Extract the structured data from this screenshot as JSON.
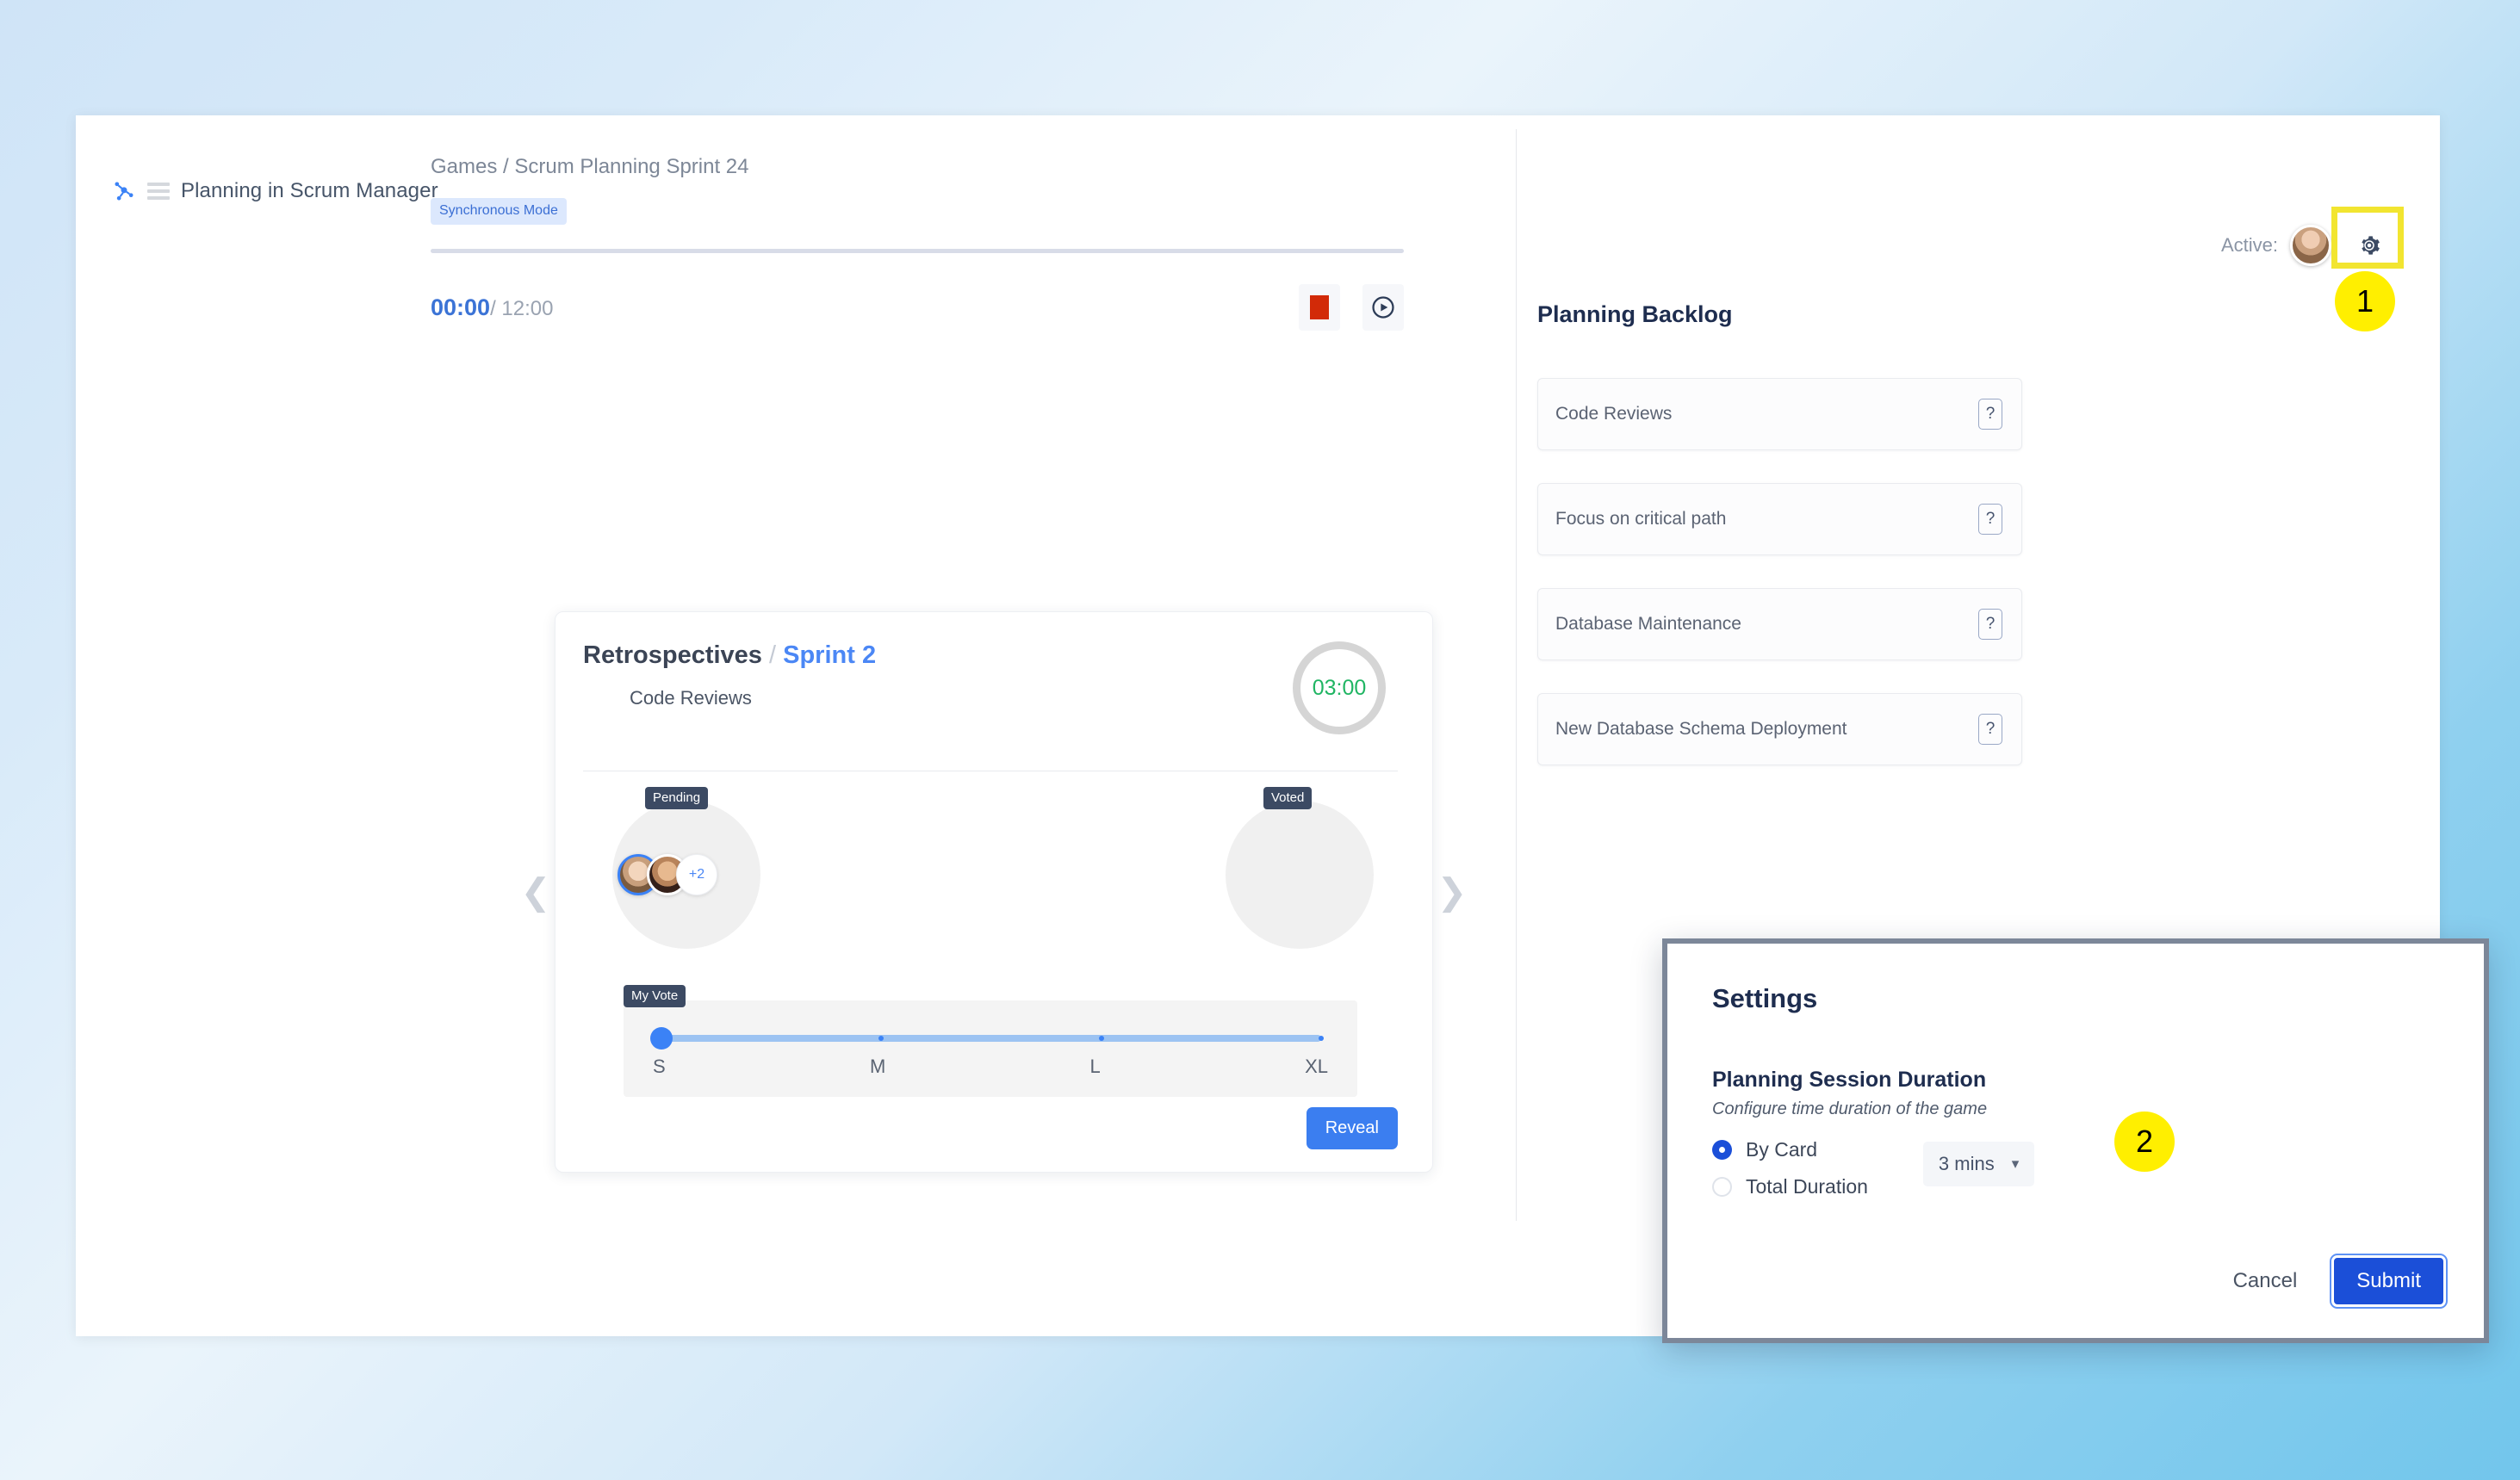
{
  "app": {
    "brand_title": "Planning in Scrum Manager",
    "logo_icon": "scrum-node-logo-icon",
    "menu_icon": "hamburger-menu-icon"
  },
  "header": {
    "active_label": "Active:",
    "avatar_name": "active-user-avatar",
    "gear_icon": "gear-icon"
  },
  "annotations": [
    {
      "id": "1",
      "label": "1"
    },
    {
      "id": "2",
      "label": "2"
    }
  ],
  "main": {
    "breadcrumb": "Games / Scrum Planning Sprint 24",
    "mode_badge": "Synchronous Mode",
    "timer": {
      "elapsed": "00:00",
      "total": "/ 12:00",
      "stop_icon": "stop-icon",
      "play_icon": "play-circle-icon"
    },
    "carousel": {
      "prev_icon": "chevron-left-icon",
      "next_icon": "chevron-right-icon"
    },
    "card": {
      "title": "Retrospectives",
      "separator": "/",
      "sprint": "Sprint 2",
      "subtitle": "Code Reviews",
      "ring_timer": "03:00",
      "pending_tag": "Pending",
      "voted_tag": "Voted",
      "extra_avatars": "+2",
      "slider": {
        "tag": "My Vote",
        "labels": [
          "S",
          "M",
          "L",
          "XL"
        ],
        "value": "S"
      },
      "reveal_label": "Reveal"
    }
  },
  "backlog": {
    "title": "Planning Backlog",
    "help_icon": "question-mark-icon",
    "items": [
      {
        "label": "Code Reviews",
        "badge": "?"
      },
      {
        "label": "Focus on critical path",
        "badge": "?"
      },
      {
        "label": "Database Maintenance",
        "badge": "?"
      },
      {
        "label": "New Database Schema Deployment",
        "badge": "?"
      }
    ]
  },
  "settings_modal": {
    "title": "Settings",
    "section_title": "Planning Session Duration",
    "section_subtitle": "Configure time duration of the game",
    "options": [
      {
        "label": "By Card",
        "selected": true
      },
      {
        "label": "Total Duration",
        "selected": false
      }
    ],
    "duration_value": "3 mins",
    "duration_chevron": "chevron-down-icon",
    "cancel_label": "Cancel",
    "submit_label": "Submit"
  },
  "colors": {
    "accent_blue": "#3b7ef0",
    "submit_blue": "#1b4fd8",
    "highlight_yellow": "#ffef00",
    "stop_red": "#d22a08",
    "ring_green": "#20b563",
    "tag_navy": "#3c4a63"
  }
}
